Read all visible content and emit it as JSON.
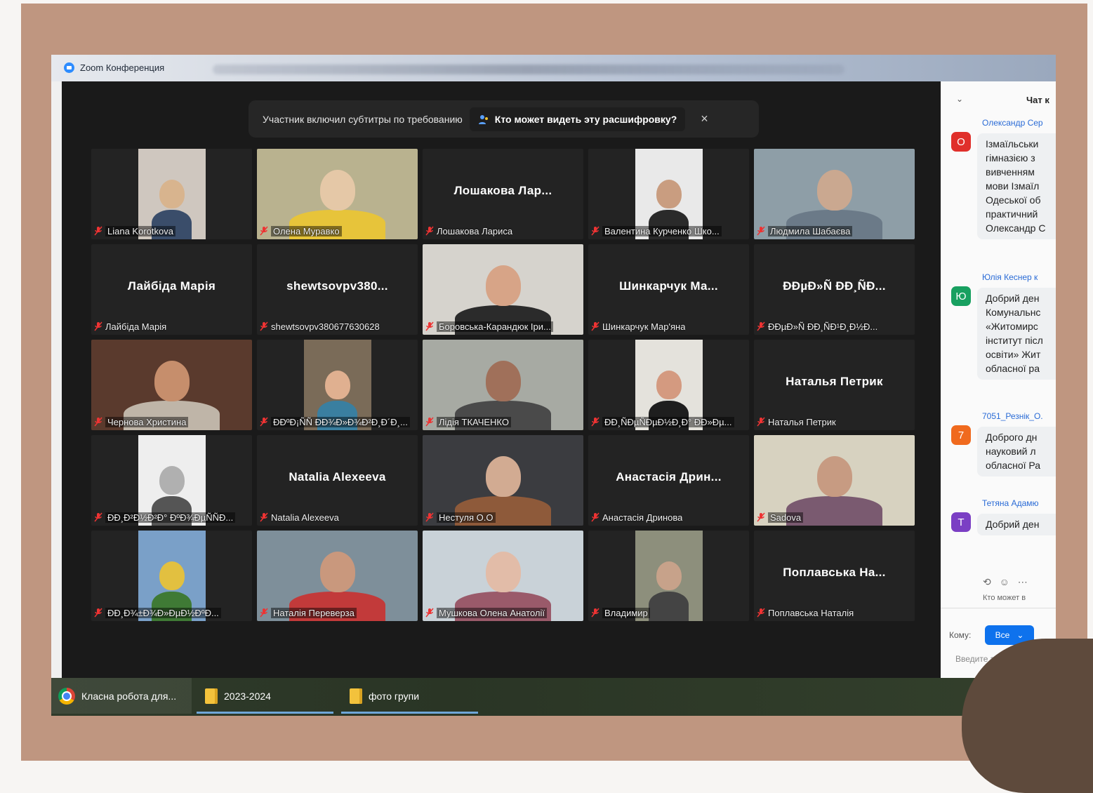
{
  "window": {
    "title": "Zoom Конференция"
  },
  "notice": {
    "text": "Участник включил субтитры по требованию",
    "link": "Кто может видеть эту расшифровку?",
    "close": "×"
  },
  "participants": [
    {
      "label": "Liana Korotkova",
      "big": "",
      "video": true
    },
    {
      "label": "Олена Муравко",
      "big": "",
      "video": true
    },
    {
      "label": "Лошакова Лариса",
      "big": "Лошакова Лар...",
      "video": false
    },
    {
      "label": "Валентина Курченко Шко...",
      "big": "",
      "video": true
    },
    {
      "label": "Людмила Шабаєва",
      "big": "",
      "video": true
    },
    {
      "label": "Лайбіда Марія",
      "big": "Лайбіда Марія",
      "video": false
    },
    {
      "label": "shewtsovpv380677630628",
      "big": "shewtsovpv380...",
      "video": false
    },
    {
      "label": "Боровська-Карандюк Іри...",
      "big": "",
      "video": true
    },
    {
      "label": "Шинкарчук Мар'яна",
      "big": "Шинкарчук Ма...",
      "video": false
    },
    {
      "label": "ÐÐµÐ»Ñ ÐÐ¸ÑÐ¹Ð¸Ð½Ð...",
      "big": "ÐÐµÐ»Ñ ÐÐ¸ÑÐ...",
      "video": false
    },
    {
      "label": "Чернова Христина",
      "big": "",
      "video": true
    },
    {
      "label": "ÐÐºÐ¡ÑÑ ÐÐ¾Ð»Ð¾Ð²Ð¸Ð´Ð¸...",
      "big": "",
      "video": true
    },
    {
      "label": "Лідія ТКАЧЕНКО",
      "big": "",
      "video": true
    },
    {
      "label": "ÐÐ¸ÑÐµÑÐµÐ½Ð¸Ð° ÐÐ»Ðµ...",
      "big": "",
      "video": true
    },
    {
      "label": "Наталья Петрик",
      "big": "Наталья Петрик",
      "video": false
    },
    {
      "label": "ÐÐ¸Ð²Ð½Ð²Ð° ÐºÐ¾ÐµÑÑÐ...",
      "big": "",
      "video": true
    },
    {
      "label": "Natalia Alexeeva",
      "big": "Natalia Alexeeva",
      "video": false
    },
    {
      "label": "Нестуля О.О",
      "big": "",
      "video": true
    },
    {
      "label": "Анастасія Дринова",
      "big": "Анастасія Дрин...",
      "video": false
    },
    {
      "label": "Sadova",
      "big": "",
      "video": true
    },
    {
      "label": "ÐÐ¸Ð¾±Ð¾Ð»ÐµÐ½ÐºÐ...",
      "big": "",
      "video": true
    },
    {
      "label": "Наталія Переверза",
      "big": "",
      "video": true
    },
    {
      "label": "Мушкова Олена Анатолії",
      "big": "",
      "video": true
    },
    {
      "label": "Владимир",
      "big": "",
      "video": true
    },
    {
      "label": "Поплавська Наталія",
      "big": "Поплавська На...",
      "video": false
    }
  ],
  "chat": {
    "title": "Чат к",
    "messages": [
      {
        "sender": "Олександр Сер",
        "avatar": "О",
        "color": "#e0302b",
        "lines": [
          "Ізмаїльськи",
          "гімназією з",
          "вивченням",
          "мови Ізмаїл",
          "Одеської об",
          "практичний",
          "Олександр С"
        ]
      },
      {
        "sender": "Юлія Кеснер к",
        "avatar": "Ю",
        "color": "#18a060",
        "lines": [
          "Добрий ден",
          "Комунальнс",
          "«Житомирс",
          "інститут післ",
          "освіти» Жит",
          "обласної ра"
        ]
      },
      {
        "sender": "7051_Резнік_О.",
        "avatar": "7",
        "color": "#f06a1e",
        "lines": [
          "Доброго дн",
          "науковий л",
          "обласної Ра"
        ]
      },
      {
        "sender": "Тетяна Адамю",
        "avatar": "Т",
        "color": "#7b3fc4",
        "lines": [
          "Добрий ден"
        ]
      }
    ],
    "who_can_see": "Кто может в",
    "to_label": "Кому:",
    "to_value": "Все",
    "input_placeholder": "Введите здесь сообщ"
  },
  "taskbar": {
    "items": [
      "Класна робота для...",
      "2023-2024",
      "фото групи"
    ]
  }
}
